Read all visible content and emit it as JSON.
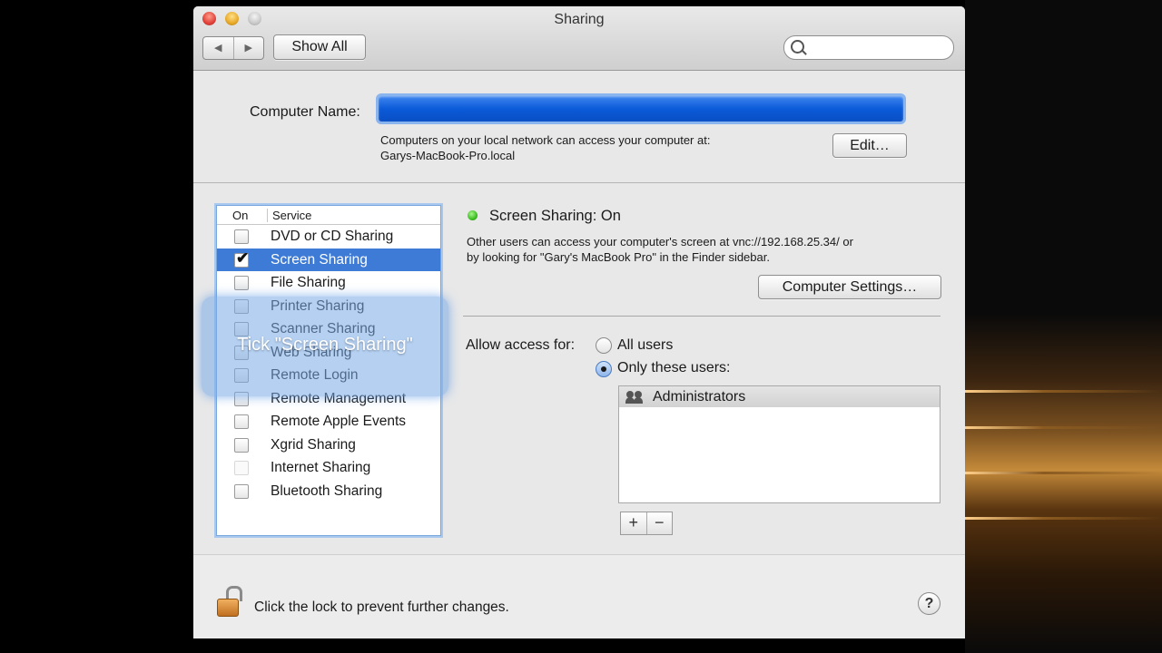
{
  "window": {
    "title": "Sharing"
  },
  "toolbar": {
    "back_label": "◀",
    "forward_label": "▶",
    "show_all": "Show All",
    "search_placeholder": ""
  },
  "computer_name": {
    "label": "Computer Name:",
    "value": "",
    "info_line1": "Computers on your local network can access your computer at:",
    "info_line2": "Garys-MacBook-Pro.local",
    "edit_button": "Edit…"
  },
  "services": {
    "header_on": "On",
    "header_service": "Service",
    "items": [
      {
        "label": "DVD or CD Sharing",
        "checked": false,
        "selected": false,
        "enabled": true
      },
      {
        "label": "Screen Sharing",
        "checked": true,
        "selected": true,
        "enabled": true
      },
      {
        "label": "File Sharing",
        "checked": false,
        "selected": false,
        "enabled": true
      },
      {
        "label": "Printer Sharing",
        "checked": false,
        "selected": false,
        "enabled": true
      },
      {
        "label": "Scanner Sharing",
        "checked": false,
        "selected": false,
        "enabled": true
      },
      {
        "label": "Web Sharing",
        "checked": false,
        "selected": false,
        "enabled": true
      },
      {
        "label": "Remote Login",
        "checked": false,
        "selected": false,
        "enabled": true
      },
      {
        "label": "Remote Management",
        "checked": false,
        "selected": false,
        "enabled": true
      },
      {
        "label": "Remote Apple Events",
        "checked": false,
        "selected": false,
        "enabled": true
      },
      {
        "label": "Xgrid Sharing",
        "checked": false,
        "selected": false,
        "enabled": true
      },
      {
        "label": "Internet Sharing",
        "checked": false,
        "selected": false,
        "enabled": false
      },
      {
        "label": "Bluetooth Sharing",
        "checked": false,
        "selected": false,
        "enabled": true
      }
    ]
  },
  "overlay": {
    "text": "Tick \"Screen Sharing\""
  },
  "detail": {
    "status": "Screen Sharing: On",
    "status_color": "#3cbf22",
    "desc_line1": "Other users can access your computer's screen at vnc://192.168.25.34/ or",
    "desc_line2": "by looking for \"Gary's MacBook Pro\" in the Finder sidebar.",
    "computer_settings": "Computer Settings…",
    "allow_label": "Allow access for:",
    "option_all": "All users",
    "option_only": "Only these users:",
    "selected_option": "Only these users:",
    "users": [
      {
        "name": "Administrators",
        "icon": "group-icon"
      }
    ],
    "add_label": "+",
    "remove_label": "−"
  },
  "footer": {
    "lock_text": "Click the lock to prevent further changes.",
    "help_label": "?"
  },
  "colors": {
    "selection": "#3e7bd6",
    "name_field": "#0b5ad8"
  }
}
